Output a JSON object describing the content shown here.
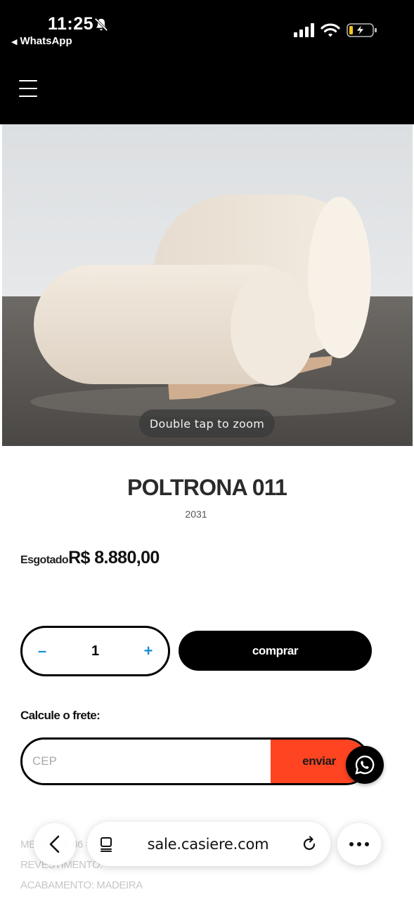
{
  "status_bar": {
    "time": "11:25",
    "back_app": "WhatsApp",
    "icons": [
      "bell-slash-icon",
      "signal-icon",
      "wifi-icon",
      "battery-charging-icon"
    ]
  },
  "header": {
    "menu_icon": "hamburger-icon"
  },
  "hero": {
    "zoom_hint": "Double tap to zoom"
  },
  "product": {
    "title": "POLTRONA 011",
    "sku": "2031",
    "sold_out": "Esgotado",
    "price": "R$ 8.880,00"
  },
  "purchase": {
    "minus": "–",
    "quantity": "1",
    "plus": "+",
    "buy_label": "comprar",
    "accent": "#1a8fd6"
  },
  "shipping": {
    "label": "Calcule o frete:",
    "placeholder": "CEP",
    "send_label": "enviar",
    "send_color": "#ff4422"
  },
  "specs": {
    "line1": "MEDIDAS: 86 ×",
    "line2": "REVESTIMENTO:",
    "line3": "ACABAMENTO: MADEIRA"
  },
  "browser": {
    "url": "sale.casiere.com",
    "icons": [
      "back-chevron-icon",
      "tabs-icon",
      "reload-icon",
      "more-icon"
    ]
  },
  "floating": {
    "icon": "whatsapp-icon"
  }
}
